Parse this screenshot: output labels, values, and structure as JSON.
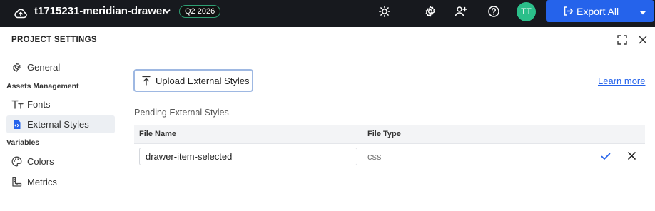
{
  "topbar": {
    "project_name": "t1715231-meridian-drawer",
    "badge": "Q2 2026",
    "avatar_initials": "TT",
    "export_label": "Export All",
    "icons": [
      "cloud-upload-icon",
      "chevron-down-icon",
      "sun-icon",
      "gear-icon",
      "user-plus-icon",
      "help-icon",
      "export-icon",
      "caret-down-icon"
    ]
  },
  "panel": {
    "title": "PROJECT SETTINGS"
  },
  "sidebar": {
    "general": "General",
    "assets_heading": "Assets Management",
    "fonts": "Fonts",
    "external_styles": "External Styles",
    "variables_heading": "Variables",
    "colors": "Colors",
    "metrics": "Metrics",
    "active": "External Styles"
  },
  "main": {
    "upload_label": "Upload External Styles",
    "learn_more": "Learn more",
    "pending_title": "Pending External Styles",
    "columns": [
      "File Name",
      "File Type"
    ],
    "rows": [
      {
        "file_name": "drawer-item-selected",
        "file_type": "css"
      }
    ]
  },
  "colors": {
    "topbar_bg": "#17191e",
    "accent": "#2563eb",
    "avatar": "#2bbf8a",
    "badge_border": "#2e9f73"
  }
}
